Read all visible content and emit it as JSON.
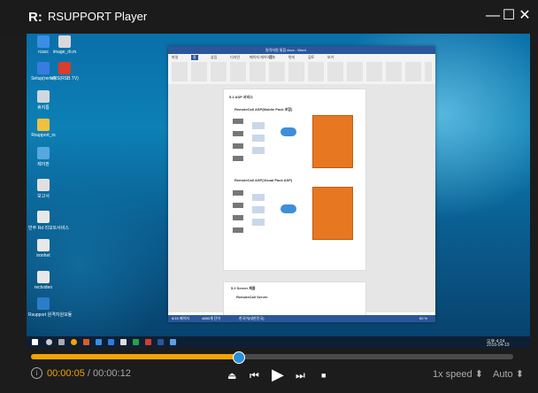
{
  "app": {
    "logo": "R:",
    "title": "RSUPPORT Player"
  },
  "window_controls": {
    "minimize": "—",
    "maximize": "☐",
    "close": "✕"
  },
  "desktop": {
    "icons": [
      {
        "label": "rcasc",
        "color": "#3a8ee6"
      },
      {
        "label": "image_rb.m",
        "color": "#d9d9d9"
      },
      {
        "label": "Setup(remo)",
        "color": "#3a7be0"
      },
      {
        "label": "VRS(RSB.TV)",
        "color": "#d93d2b"
      },
      {
        "label": "휴지통",
        "color": "#cfd8e0"
      },
      {
        "label": "Rsupport_rs",
        "color": "#f0c040"
      },
      {
        "label": "제어판",
        "color": "#55a8e0"
      },
      {
        "label": "보고서",
        "color": "#e0e0e0"
      },
      {
        "label": "반주 Rd 리모트서비스",
        "color": "#e8e8e8"
      },
      {
        "label": "ironhet",
        "color": "#e8e8e8"
      },
      {
        "label": "rectvideo",
        "color": "#e8e8e8"
      },
      {
        "label": "Rsupport 원격지원모듈",
        "color": "#2b7dc8"
      }
    ]
  },
  "taskbar": {
    "tray_time": "오후 4:24",
    "tray_date": "2016-04-19"
  },
  "document": {
    "title": "원격지원 통합.docx - Word",
    "tabs": [
      "파일",
      "홈",
      "삽입",
      "디자인",
      "페이지 레이아웃",
      "참조",
      "편지",
      "검토",
      "보기"
    ],
    "section_1": "5.1 ASP 서비스",
    "diagram_1": "RemoteCall ASP(Mobile Pack 포함)",
    "diagram_2": "RemoteCall ASP(Visual Pack ASP)",
    "section_2": "5.2 Server 제품",
    "server_line": "RemoteCall Server",
    "status_left": "6/15 페이지",
    "status_words": "4880개 단어",
    "status_lang": "한국어(대한민국)",
    "zoom": "60 %"
  },
  "player": {
    "progress": 0.43,
    "current_time": "00:00:05",
    "separator": " / ",
    "total_time": "00:00:12",
    "info_icon": "i",
    "buttons": {
      "eject": "⏏",
      "prev": "⏮",
      "play": "▶",
      "next": "⏭",
      "stop": "■"
    },
    "speed_label": "1x speed",
    "quality_label": "Auto"
  },
  "colors": {
    "accent": "#f2a400",
    "thumb": "#2a8fd8",
    "word_blue": "#2b579a",
    "diagram_orange": "#e87722"
  }
}
